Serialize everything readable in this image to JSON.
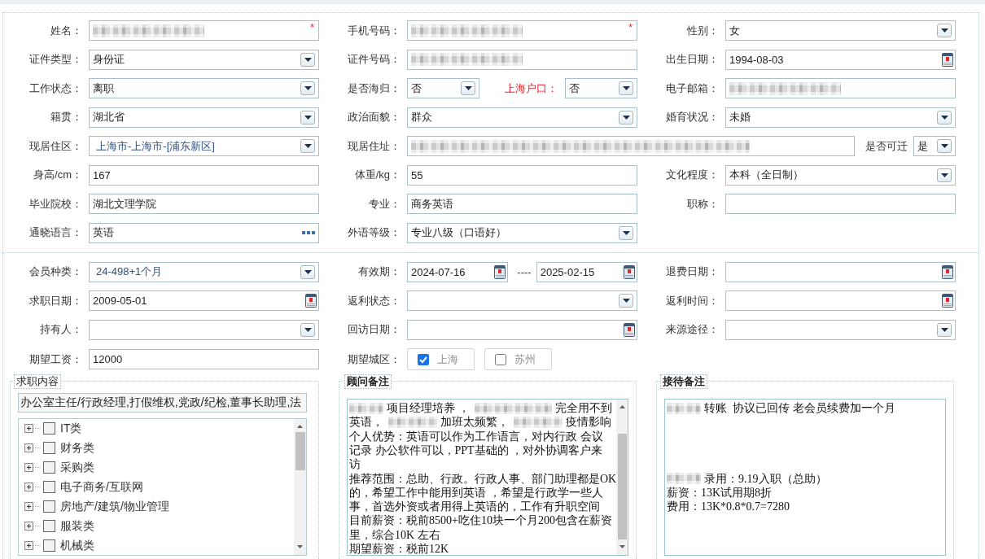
{
  "profile": {
    "rows": [
      {
        "groups": [
          {
            "label": "姓名：",
            "controls": [
              {
                "kind": "text",
                "blurred": true,
                "required_mark": "*"
              }
            ]
          },
          {
            "label": "手机号码：",
            "controls": [
              {
                "kind": "text",
                "blurred": true,
                "required_mark": "*"
              }
            ]
          },
          {
            "label": "性别：",
            "controls": [
              {
                "kind": "select",
                "value": "女"
              }
            ]
          }
        ]
      },
      {
        "groups": [
          {
            "label": "证件类型：",
            "controls": [
              {
                "kind": "select",
                "value": "身份证"
              }
            ]
          },
          {
            "label": "证件号码：",
            "controls": [
              {
                "kind": "text",
                "blurred": true
              }
            ]
          },
          {
            "label": "出生日期：",
            "controls": [
              {
                "kind": "date",
                "value": "1994-08-03"
              }
            ]
          }
        ]
      },
      {
        "groups": [
          {
            "label": "工作状态：",
            "controls": [
              {
                "kind": "select",
                "value": "离职"
              }
            ]
          },
          {
            "label": "是否海归：",
            "controls": [
              {
                "kind": "select",
                "value": "否"
              },
              {
                "kind": "label",
                "text": "上海户口：",
                "emphasis": true
              },
              {
                "kind": "select",
                "value": "否"
              }
            ]
          },
          {
            "label": "电子邮箱：",
            "controls": [
              {
                "kind": "text",
                "blurred": true
              }
            ]
          }
        ]
      },
      {
        "groups": [
          {
            "label": "籍贯：",
            "controls": [
              {
                "kind": "select",
                "value": "湖北省"
              }
            ]
          },
          {
            "label": "政治面貌：",
            "controls": [
              {
                "kind": "select",
                "value": "群众"
              }
            ]
          },
          {
            "label": "婚育状况：",
            "controls": [
              {
                "kind": "select",
                "value": "未婚"
              }
            ]
          }
        ]
      },
      {
        "groups": [
          {
            "label": "现居住区：",
            "controls": [
              {
                "kind": "combo",
                "value": "上海市-上海市-[浦东新区]"
              }
            ]
          },
          {
            "label": "现居住址：",
            "wide": true,
            "controls": [
              {
                "kind": "text",
                "blurred": true
              },
              {
                "kind": "label",
                "text": "是否可迁",
                "emphasis": false
              },
              {
                "kind": "select",
                "value": "是"
              }
            ]
          }
        ]
      },
      {
        "groups": [
          {
            "label": "身高/cm：",
            "controls": [
              {
                "kind": "text",
                "value": "167"
              }
            ]
          },
          {
            "label": "体重/kg：",
            "controls": [
              {
                "kind": "text",
                "value": "55"
              }
            ]
          },
          {
            "label": "文化程度：",
            "controls": [
              {
                "kind": "select",
                "value": "本科（全日制）"
              }
            ]
          }
        ]
      },
      {
        "groups": [
          {
            "label": "毕业院校：",
            "controls": [
              {
                "kind": "text",
                "value": "湖北文理学院"
              }
            ]
          },
          {
            "label": "专业：",
            "controls": [
              {
                "kind": "text",
                "value": "商务英语"
              }
            ]
          },
          {
            "label": "职称：",
            "controls": [
              {
                "kind": "text"
              }
            ]
          }
        ]
      },
      {
        "groups": [
          {
            "label": "通晓语言：",
            "controls": [
              {
                "kind": "picker",
                "value": "英语"
              }
            ]
          },
          {
            "label": "外语等级：",
            "controls": [
              {
                "kind": "select",
                "value": "专业八级（口语好）"
              }
            ]
          }
        ]
      }
    ]
  },
  "membership": {
    "rows": [
      {
        "groups": [
          {
            "label": "会员种类：",
            "controls": [
              {
                "kind": "combo",
                "value": "24-498+1个月"
              }
            ]
          },
          {
            "label": "有效期：",
            "controls": [
              {
                "kind": "date",
                "value": "2024-07-16"
              },
              {
                "kind": "separator",
                "text": "----"
              },
              {
                "kind": "date",
                "value": "2025-02-15"
              }
            ]
          },
          {
            "label": "退费日期：",
            "controls": [
              {
                "kind": "date"
              }
            ]
          }
        ]
      },
      {
        "groups": [
          {
            "label": "求职日期：",
            "controls": [
              {
                "kind": "date",
                "value": "2009-05-01"
              }
            ]
          },
          {
            "label": "返利状态：",
            "controls": [
              {
                "kind": "select"
              }
            ]
          },
          {
            "label": "返利时间：",
            "controls": [
              {
                "kind": "date"
              }
            ]
          }
        ]
      },
      {
        "groups": [
          {
            "label": "持有人：",
            "controls": [
              {
                "kind": "select"
              }
            ]
          },
          {
            "label": "回访日期：",
            "controls": [
              {
                "kind": "date"
              }
            ]
          },
          {
            "label": "来源途径：",
            "controls": [
              {
                "kind": "select"
              }
            ]
          }
        ]
      },
      {
        "groups": [
          {
            "label": "期望工资：",
            "controls": [
              {
                "kind": "text",
                "value": "12000"
              }
            ]
          },
          {
            "label": "期望城区：",
            "controls": [
              {
                "kind": "check",
                "text": "上海",
                "checked": true
              },
              {
                "kind": "check",
                "text": "苏州",
                "checked": false
              }
            ]
          }
        ]
      }
    ]
  },
  "job_intent": {
    "legend": "求职内容",
    "summary": "办公室主任/行政经理,打假维权,党政/纪检,董事长助理,法",
    "categories": [
      {
        "label": "IT类",
        "expanded": false,
        "checked": false
      },
      {
        "label": "财务类",
        "expanded": false,
        "checked": false
      },
      {
        "label": "采购类",
        "expanded": false,
        "checked": false
      },
      {
        "label": "电子商务/互联网",
        "expanded": false,
        "checked": false
      },
      {
        "label": "房地产/建筑/物业管理",
        "expanded": false,
        "checked": false
      },
      {
        "label": "服装类",
        "expanded": false,
        "checked": false
      },
      {
        "label": "机械类",
        "expanded": false,
        "checked": false
      }
    ]
  },
  "consultant_notes": {
    "legend": "顾问备注",
    "lines": [
      {
        "kind": "line",
        "parts": [
          {
            "kind": "blur"
          },
          {
            "kind": "text",
            "text": "项目经理培养 ，"
          },
          {
            "kind": "longblur"
          },
          {
            "kind": "text",
            "text": "完全用不到"
          }
        ]
      },
      {
        "kind": "line",
        "parts": [
          {
            "kind": "text",
            "text": "英语，"
          },
          {
            "kind": "midblur"
          },
          {
            "kind": "text",
            "text": "加班太频繁，"
          },
          {
            "kind": "midblur"
          },
          {
            "kind": "text",
            "text": "疫情影响"
          }
        ]
      },
      {
        "kind": "line",
        "parts": [
          {
            "kind": "text",
            "text": "个人优势：英语可以作为工作语言，对内行政 会议"
          }
        ]
      },
      {
        "kind": "line",
        "parts": [
          {
            "kind": "text",
            "text": "记录 办公软件可以，PPT基础的 ，对外协调客户来"
          }
        ]
      },
      {
        "kind": "line",
        "parts": [
          {
            "kind": "text",
            "text": "访"
          }
        ]
      },
      {
        "kind": "line",
        "parts": [
          {
            "kind": "text",
            "text": "推荐范围：总助、行政。行政人事、部门助理都是OK"
          }
        ]
      },
      {
        "kind": "line",
        "parts": [
          {
            "kind": "text",
            "text": "的，希望工作中能用到英语 ，希望是行政学一些人"
          }
        ]
      },
      {
        "kind": "line",
        "parts": [
          {
            "kind": "text",
            "text": "事，首选外资或者用得上英语的，工作有升职空间"
          }
        ]
      },
      {
        "kind": "line",
        "parts": [
          {
            "kind": "text",
            "text": "目前薪资：税前8500+吃住10块一个月200包含在薪资"
          }
        ]
      },
      {
        "kind": "line",
        "parts": [
          {
            "kind": "text",
            "text": "里，综合10K 左右"
          }
        ]
      },
      {
        "kind": "line",
        "parts": [
          {
            "kind": "text",
            "text": "期望薪资：税前12K"
          }
        ]
      }
    ]
  },
  "reception_notes": {
    "legend": "接待备注",
    "lines": [
      {
        "kind": "line",
        "parts": [
          {
            "kind": "blur"
          },
          {
            "kind": "text",
            "text": "转账  协议已回传 老会员续费加一个月"
          }
        ]
      },
      {
        "kind": "blank"
      },
      {
        "kind": "blank"
      },
      {
        "kind": "line",
        "parts": [
          {
            "kind": "blur"
          },
          {
            "kind": "text",
            "text": "录用：9.19入职（总助）"
          }
        ]
      },
      {
        "kind": "line",
        "parts": [
          {
            "kind": "text",
            "text": "薪资：13K试用期8折"
          }
        ]
      },
      {
        "kind": "line",
        "parts": [
          {
            "kind": "text",
            "text": "费用：13K*0.8*0.7=7280"
          }
        ]
      }
    ]
  }
}
